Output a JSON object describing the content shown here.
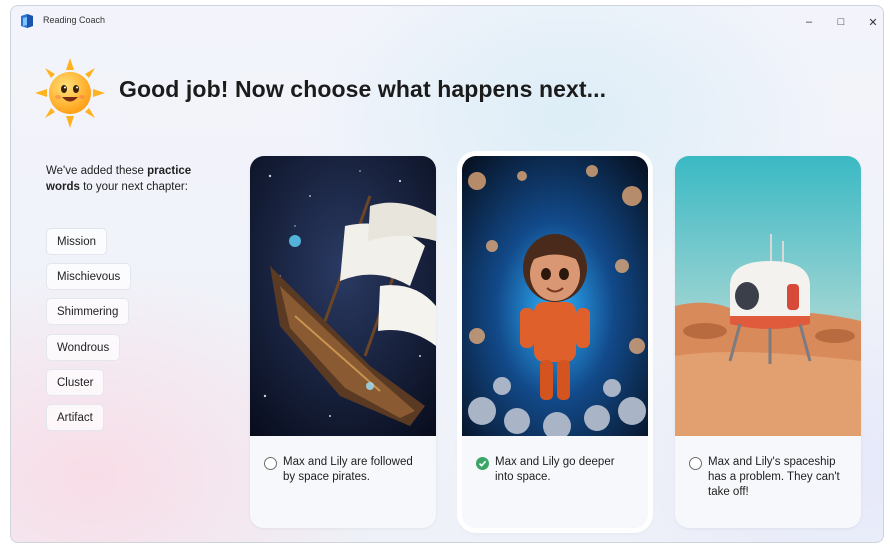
{
  "window": {
    "title": "Reading Coach",
    "controls": {
      "minimize": "–",
      "maximize": "□",
      "close": "✕"
    },
    "app_icon": "book-icon"
  },
  "heading": {
    "text": "Good job!  Now choose what happens next...",
    "mascot_icon": "sun-mascot-icon"
  },
  "practice": {
    "intro_prefix": "We've added these ",
    "intro_bold1": "practice",
    "intro_bold2": "words",
    "intro_suffix": " to your next chapter:",
    "words": [
      "Mission",
      "Mischievous",
      "Shimmering",
      "Wondrous",
      "Cluster",
      "Artifact"
    ]
  },
  "choices": [
    {
      "text": "Max and Lily are followed by space pirates.",
      "selected": false,
      "image": "pirate-ship-illustration"
    },
    {
      "text": "Max and Lily go deeper into space.",
      "selected": true,
      "image": "astronaut-child-illustration"
    },
    {
      "text": "Max and Lily's spaceship has a problem. They can't take off!",
      "selected": false,
      "image": "spaceship-on-mars-illustration"
    }
  ],
  "colors": {
    "selected_check": "#3aa566",
    "card_bg": "#f7f8fc",
    "heading": "#1b1b1b"
  }
}
